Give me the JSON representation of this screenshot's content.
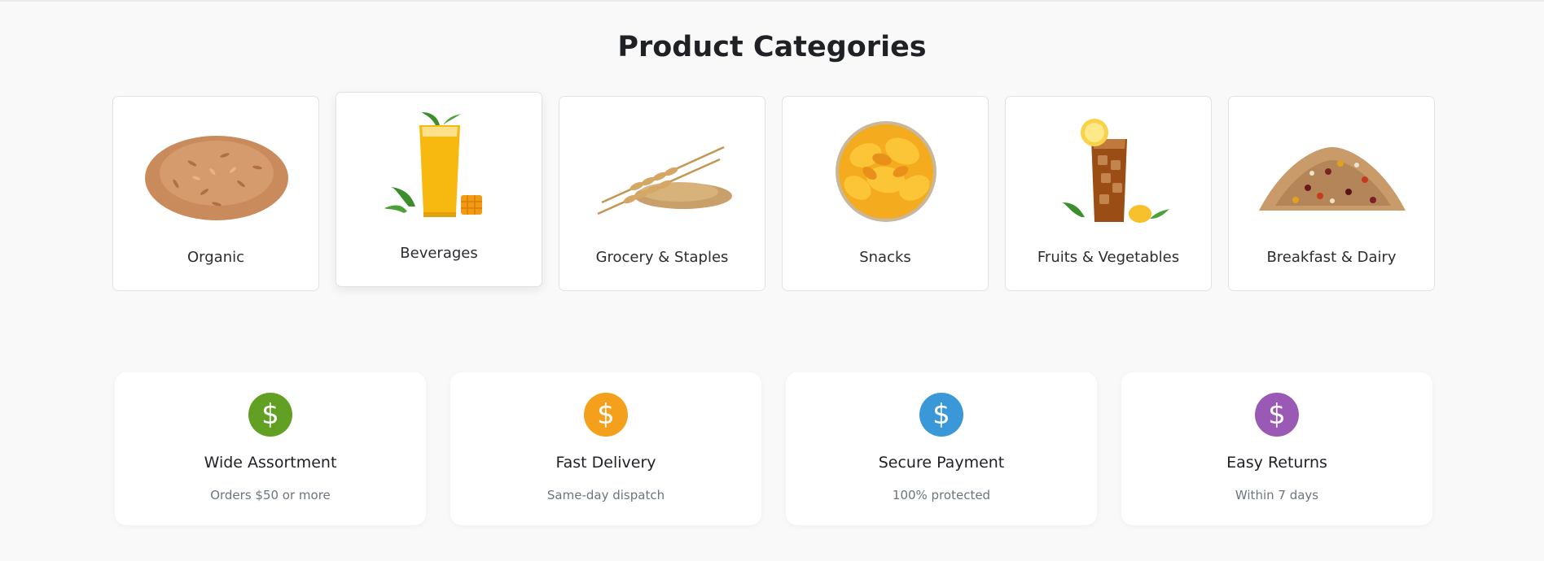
{
  "section_title": "Product Categories",
  "categories": [
    {
      "label": "Organic"
    },
    {
      "label": "Beverages"
    },
    {
      "label": "Grocery & Staples"
    },
    {
      "label": "Snacks"
    },
    {
      "label": "Fruits & Vegetables"
    },
    {
      "label": "Breakfast & Dairy"
    }
  ],
  "features": [
    {
      "title": "Wide Assortment",
      "subtitle": "Orders $50 or more",
      "icon": "dollar-icon",
      "color": "#62a024"
    },
    {
      "title": "Fast Delivery",
      "subtitle": "Same-day dispatch",
      "icon": "dollar-icon",
      "color": "#f5a01c"
    },
    {
      "title": "Secure Payment",
      "subtitle": "100% protected",
      "icon": "dollar-icon",
      "color": "#3a97d8"
    },
    {
      "title": "Easy Returns",
      "subtitle": "Within 7 days",
      "icon": "dollar-icon",
      "color": "#9b59b6"
    }
  ]
}
